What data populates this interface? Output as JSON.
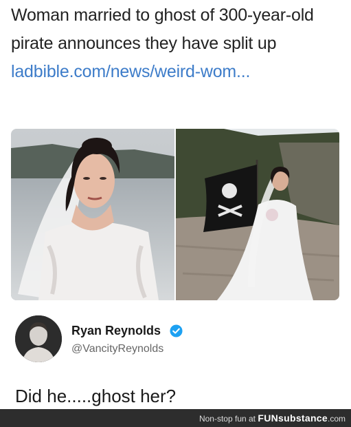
{
  "headline": {
    "text": "Woman married to ghost of 300-year-old pirate announces they have split up ",
    "link": "ladbible.com/news/weird-wom..."
  },
  "tweet": {
    "name": "Ryan Reynolds",
    "handle": "@VancityReynolds",
    "text": "Did he.....ghost her?",
    "verified_icon": "verified-check-icon"
  },
  "footer": {
    "prefix": "Non-stop fun at",
    "brand": "FUNsubstance",
    "suffix": ".com"
  },
  "colors": {
    "link": "#3d7cc9",
    "verified": "#1da1f2",
    "footer_bg": "#2d2d2d"
  }
}
